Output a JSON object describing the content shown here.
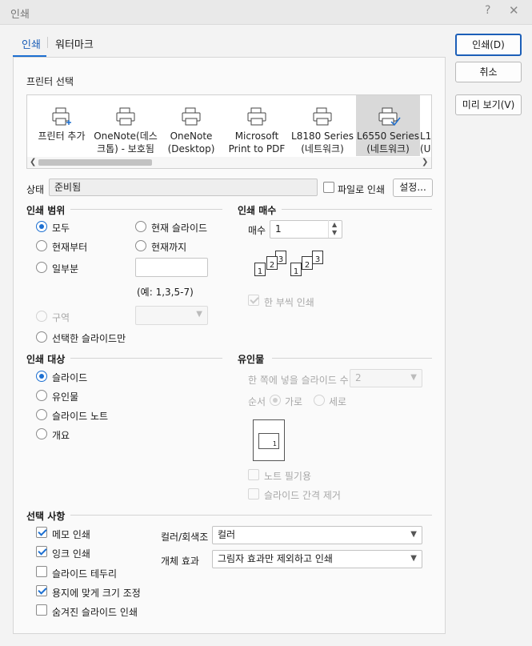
{
  "window": {
    "title": "인쇄",
    "help": "?",
    "close": "✕"
  },
  "tabs": [
    {
      "label": "인쇄"
    },
    {
      "label": "워터마크"
    }
  ],
  "side_buttons": {
    "print": "인쇄(D)",
    "cancel": "취소",
    "preview": "미리 보기(V)"
  },
  "printer_select": {
    "label": "프린터 선택",
    "printers": [
      {
        "label": "프린터 추가",
        "icon": "add-printer-icon"
      },
      {
        "label": "OneNote(데스\n크톱) - 보호됨",
        "icon": "printer-icon"
      },
      {
        "label": "OneNote\n(Desktop)",
        "icon": "printer-icon"
      },
      {
        "label": "Microsoft\nPrint to PDF",
        "icon": "printer-icon"
      },
      {
        "label": "L8180 Series\n(네트워크)",
        "icon": "printer-icon"
      },
      {
        "label": "L6550 Series\n(네트워크)",
        "icon": "default-printer-icon"
      },
      {
        "label": "L1\n(U",
        "icon": "printer-icon"
      }
    ],
    "selected_index": 5
  },
  "status": {
    "label": "상태",
    "value": "준비됨",
    "file_print_label": "파일로 인쇄",
    "settings_button": "설정..."
  },
  "print_range": {
    "title": "인쇄 범위",
    "all": "모두",
    "current_slide": "현재 슬라이드",
    "from_current": "현재부터",
    "to_current": "현재까지",
    "partial": "일부분",
    "example": "(예: 1,3,5-7)",
    "section": "구역",
    "selected_slides": "선택한 슬라이드만"
  },
  "copies": {
    "title": "인쇄 매수",
    "label": "매수",
    "value": "1",
    "collate_label": "한 부씩 인쇄"
  },
  "print_target": {
    "title": "인쇄 대상",
    "slide": "슬라이드",
    "handout": "유인물",
    "notes": "슬라이드 노트",
    "outline": "개요"
  },
  "handouts": {
    "title": "유인물",
    "per_page_label": "한 쪽에 넣을 슬라이드 수",
    "per_page_value": "2",
    "order_label": "순서",
    "horizontal": "가로",
    "vertical": "세로",
    "preview_number": "1",
    "note_lines": "노트 필기용",
    "remove_gap": "슬라이드 간격 제거"
  },
  "options": {
    "title": "선택 사항",
    "memo": "메모 인쇄",
    "ink": "잉크 인쇄",
    "slide_border": "슬라이드 테두리",
    "fit_paper": "용지에 맞게 크기 조정",
    "hidden_slides": "숨겨진 슬라이드 인쇄",
    "color_label": "컬러/회색조",
    "color_value": "컬러",
    "effect_label": "개체 효과",
    "effect_value": "그림자 효과만 제외하고 인쇄"
  },
  "colors": {
    "accent": "#1c6fd1",
    "selected_printer_bg": "#d9d9d9"
  }
}
